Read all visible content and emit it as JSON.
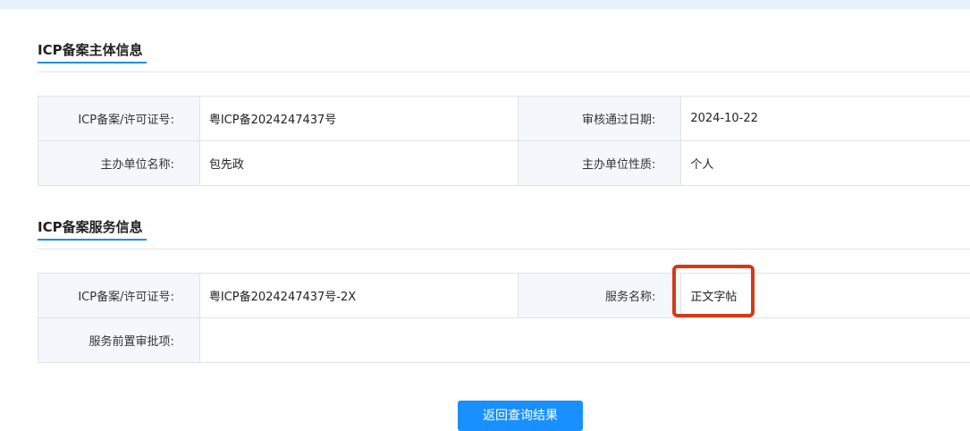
{
  "subject_section": {
    "title": "ICP备案主体信息",
    "rows": [
      {
        "label1": "ICP备案/许可证号:",
        "value1": "粤ICP备2024247437号",
        "label2": "审核通过日期:",
        "value2": "2024-10-22"
      },
      {
        "label1": "主办单位名称:",
        "value1": "包先政",
        "label2": "主办单位性质:",
        "value2": "个人"
      }
    ]
  },
  "service_section": {
    "title": "ICP备案服务信息",
    "row1": {
      "label1": "ICP备案/许可证号:",
      "value1": "粤ICP备2024247437号-2X",
      "label2": "服务名称:",
      "value2": "正文字帖"
    },
    "row2": {
      "label": "服务前置审批项:",
      "value": ""
    }
  },
  "back_button": "返回查询结果",
  "colors": {
    "accent": "#1890ff",
    "highlight": "#d23b18",
    "label_bg": "#f4f8fc"
  }
}
